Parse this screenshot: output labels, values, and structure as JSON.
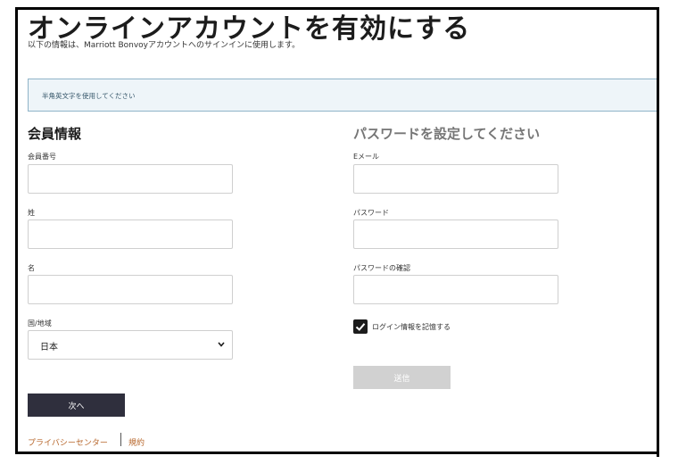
{
  "page": {
    "title": "オンラインアカウントを有効にする",
    "subtitle": "以下の情報は、Marriott Bonvoyアカウントへのサインインに使用します。"
  },
  "info_banner": {
    "text": "半角英文字を使用してください"
  },
  "member_section": {
    "heading": "会員情報",
    "member_number_label": "会員番号",
    "member_number_value": "",
    "last_name_label": "姓",
    "last_name_value": "",
    "first_name_label": "名",
    "first_name_value": "",
    "country_label": "国/地域",
    "country_value": "日本",
    "country_icon": "chevron-down-icon",
    "next_label": "次へ"
  },
  "password_section": {
    "heading": "パスワードを設定してください",
    "email_label": "Eメール",
    "email_value": "",
    "password_label": "パスワード",
    "password_value": "",
    "confirm_label": "パスワードの確認",
    "confirm_value": "",
    "remember_label": "ログイン情報を記憶する",
    "remember_checked": true,
    "submit_label": "送信"
  },
  "footer": {
    "privacy_label": "プライバシーセンター",
    "terms_label": "規約"
  },
  "colors": {
    "accent_dark": "#2f2f3d",
    "banner_bg": "#eef5f9",
    "banner_border": "#8fb4c8",
    "link": "#b7672c",
    "disabled": "#d1d1d1"
  }
}
